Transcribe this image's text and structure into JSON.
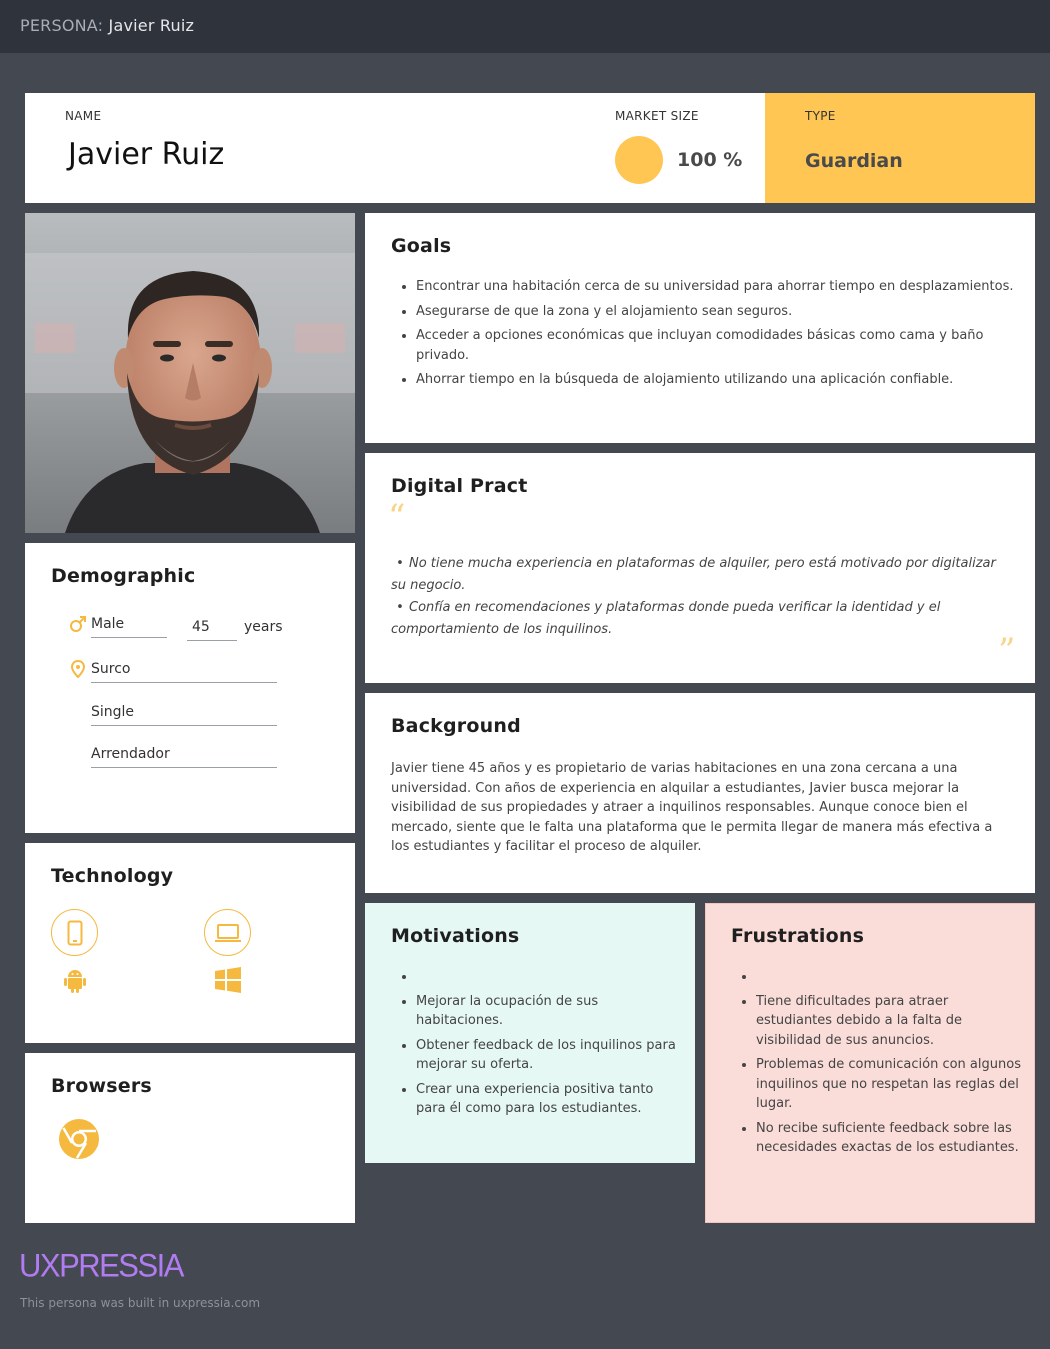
{
  "header": {
    "prefix": "PERSONA:",
    "name": "Javier Ruiz"
  },
  "top": {
    "name_label": "NAME",
    "name": "Javier Ruiz",
    "market_label": "MARKET SIZE",
    "market_value": "100 %",
    "type_label": "TYPE",
    "type_value": "Guardian"
  },
  "colors": {
    "accent": "#ffc654",
    "motivations_bg": "#e5f8f4",
    "frustrations_bg": "#fadcd9",
    "background": "#444851",
    "topbar": "#2f333b"
  },
  "demographic": {
    "title": "Demographic",
    "gender": "Male",
    "age": "45",
    "age_unit": "years",
    "location": "Surco",
    "status": "Single",
    "occupation": "Arrendador",
    "icons": [
      "male-icon",
      "location-pin-icon"
    ]
  },
  "technology": {
    "title": "Technology",
    "devices": [
      "smartphone-icon",
      "laptop-icon"
    ],
    "platforms": [
      "android-icon",
      "windows-icon"
    ]
  },
  "browsers": {
    "title": "Browsers",
    "items": [
      "chrome-icon"
    ]
  },
  "goals": {
    "title": "Goals",
    "items": [
      "Encontrar una habitación cerca de su universidad para ahorrar tiempo en desplazamientos.",
      "Asegurarse de que la zona y el alojamiento sean seguros.",
      "Acceder a opciones económicas que incluyan comodidades básicas como cama y baño privado.",
      "Ahorrar tiempo en la búsqueda de alojamiento utilizando una aplicación confiable."
    ]
  },
  "digital": {
    "title": "Digital Pract",
    "open_quote": "“",
    "close_quote": "”",
    "items": [
      "No tiene mucha experiencia en plataformas de alquiler, pero está motivado por digitalizar su negocio.",
      "Confía en recomendaciones y plataformas donde pueda verificar la identidad y el comportamiento de los inquilinos."
    ]
  },
  "background": {
    "title": "Background",
    "text": "Javier tiene 45 años y es propietario de varias habitaciones en una zona cercana a una universidad. Con años de experiencia en alquilar a estudiantes, Javier busca mejorar la visibilidad de sus propiedades y atraer a inquilinos responsables. Aunque conoce bien el mercado, siente que le falta una plataforma que le permita llegar de manera más efectiva a los estudiantes y facilitar el proceso de alquiler."
  },
  "motivations": {
    "title": "Motivations",
    "items": [
      "",
      "Mejorar la ocupación de sus habitaciones.",
      "Obtener feedback de los inquilinos para mejorar su oferta.",
      "Crear una experiencia positiva tanto para él como para los estudiantes."
    ]
  },
  "frustrations": {
    "title": "Frustrations",
    "items": [
      "",
      "Tiene dificultades para atraer estudiantes debido a la falta de visibilidad de sus anuncios.",
      "Problemas de comunicación con algunos inquilinos que no respetan las reglas del lugar.",
      "No recibe suficiente feedback sobre las necesidades exactas de los estudiantes."
    ]
  },
  "footer": {
    "logo": "UXPRESSIA",
    "note": "This persona was built in uxpressia.com"
  }
}
